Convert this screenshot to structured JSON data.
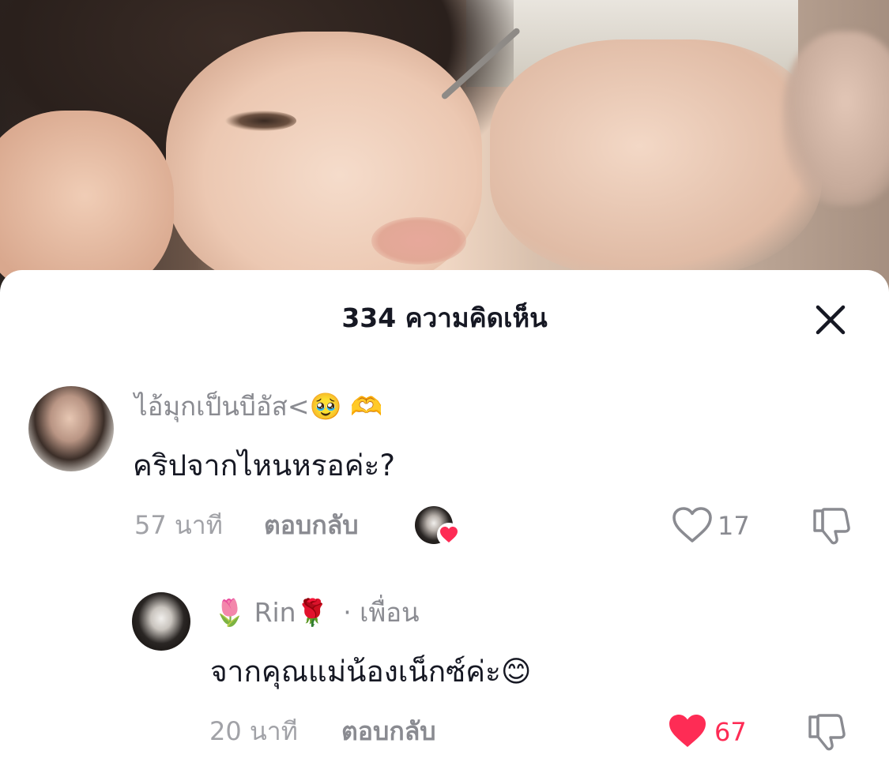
{
  "sheet": {
    "title": "334 ความคิดเห็น"
  },
  "comments": [
    {
      "username": "ไอ้มุกเป็นบีอัส<🥹 🫶",
      "text": "คริปจากไหนหรอค่ะ?",
      "time": "57 นาที",
      "reply_label": "ตอบกลับ",
      "likes": "17",
      "liked": false,
      "creator_liked": true
    },
    {
      "username": "🌷 Rin🌹",
      "badge": "· เพื่อน",
      "text": "จากคุณแม่น้องเน็กซ์ค่ะ😊",
      "time": "20 นาที",
      "reply_label": "ตอบกลับ",
      "likes": "67",
      "liked": true
    }
  ],
  "colors": {
    "like_red": "#FE2C55",
    "text_primary": "#161823",
    "text_secondary": "#8A8B91"
  },
  "icons": {
    "close": "close-icon",
    "like": "heart-icon",
    "dislike": "thumbs-down-icon"
  }
}
